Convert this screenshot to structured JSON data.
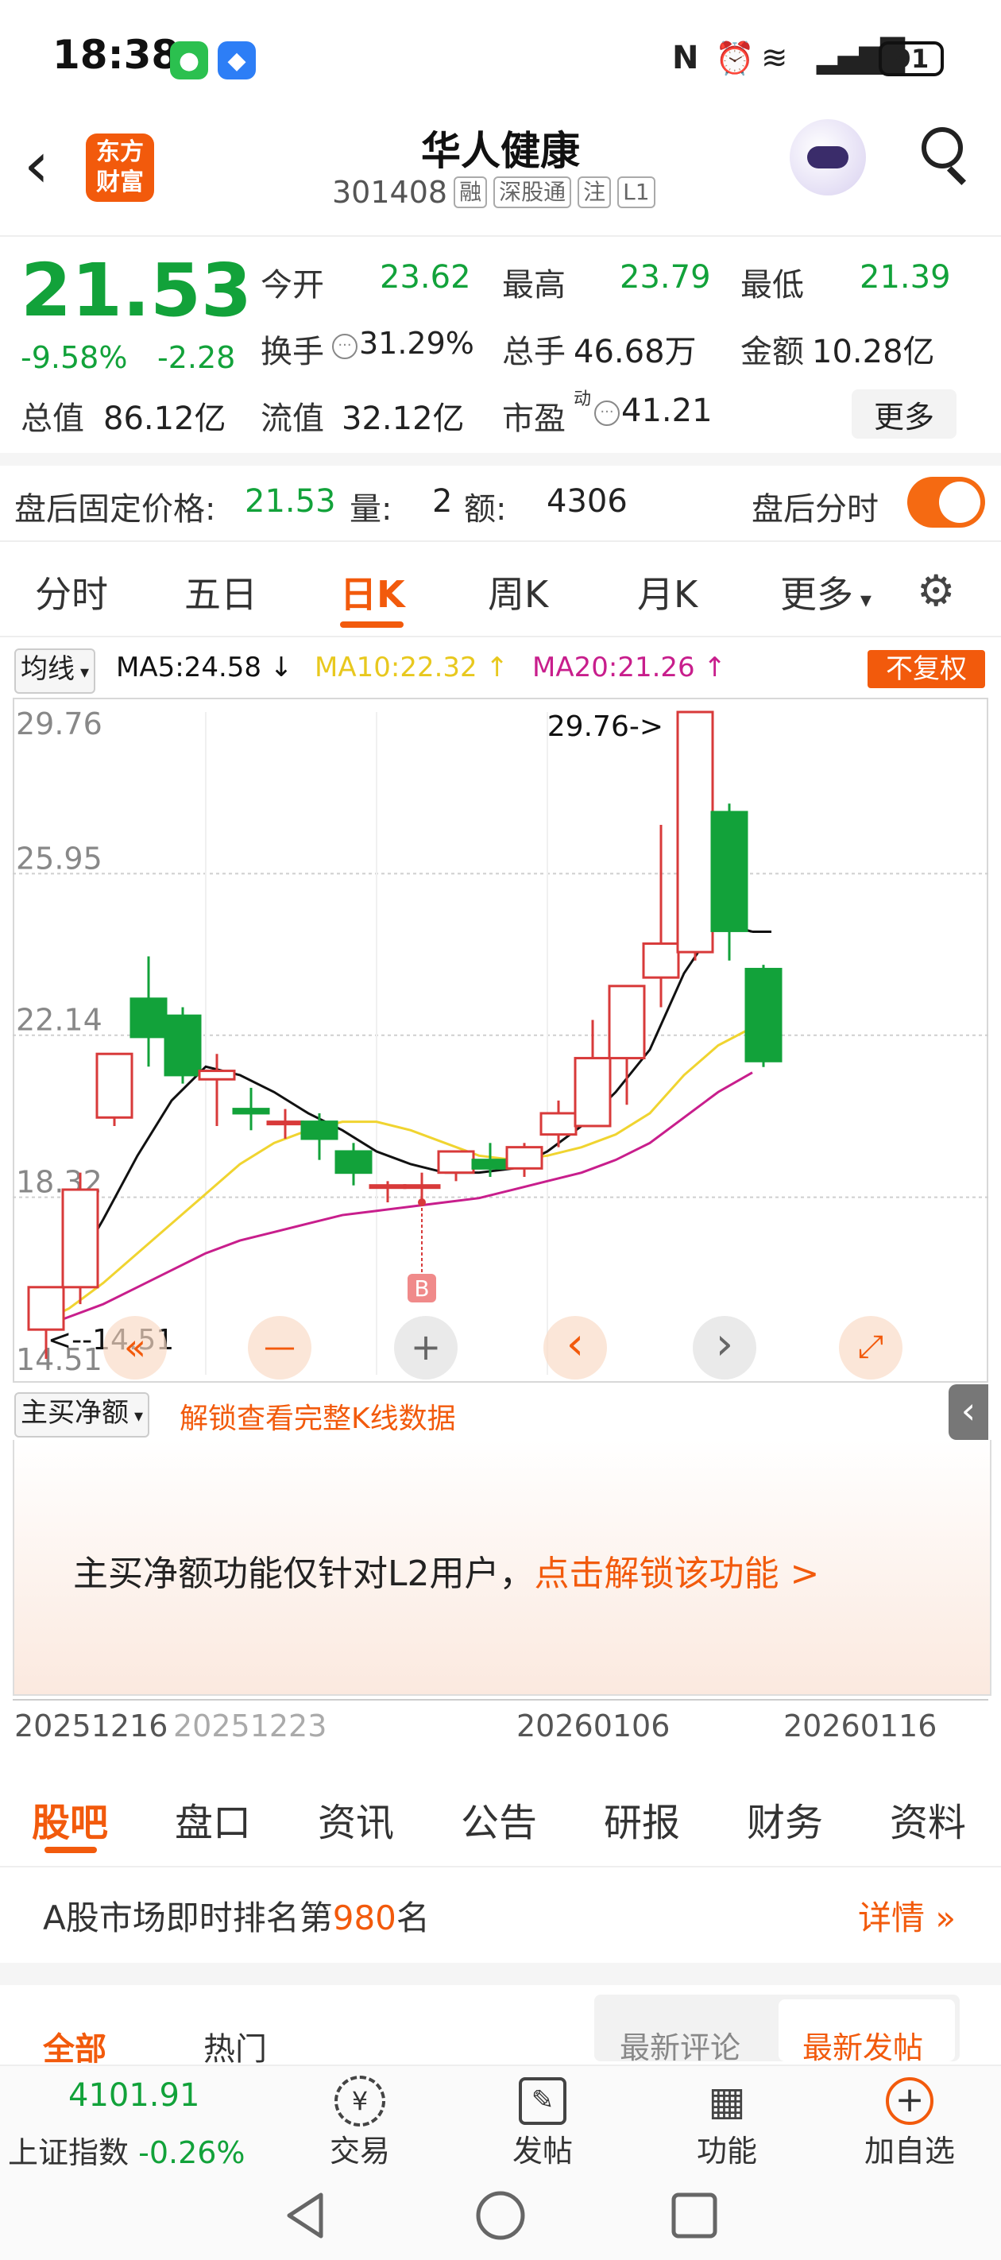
{
  "status_bar": {
    "time": "18:38",
    "battery": "91"
  },
  "header": {
    "stock_name": "华人健康",
    "stock_code": "301408",
    "tags": [
      "融",
      "深股通",
      "注",
      "L1"
    ],
    "logo_line1": "东方",
    "logo_line2": "财富"
  },
  "quote": {
    "price": "21.53",
    "change_pct": "-9.58%",
    "change_amt": "-2.28",
    "open_label": "今开",
    "open": "23.62",
    "high_label": "最高",
    "high": "23.79",
    "low_label": "最低",
    "low": "21.39",
    "turnover_label": "换手",
    "turnover": "31.29%",
    "volume_label": "总手",
    "volume": "46.68万",
    "amount_label": "金额",
    "amount": "10.28亿",
    "mktcap_label": "总值",
    "mktcap": "86.12亿",
    "float_label": "流值",
    "float": "32.12亿",
    "pe_label": "市盈",
    "pe_sup": "动",
    "pe": "41.21",
    "more": "更多"
  },
  "after_hours": {
    "label": "盘后固定价格:",
    "price": "21.53",
    "vol_label": "量:",
    "vol": "2",
    "amt_label": "额:",
    "amt": "4306",
    "toggle_label": "盘后分时",
    "toggle_on": true
  },
  "tabs": [
    "分时",
    "五日",
    "日K",
    "周K",
    "月K",
    "更多"
  ],
  "active_tab": "日K",
  "ma_row": {
    "selector": "均线",
    "ma5": "MA5:24.58",
    "ma10": "MA10:22.32",
    "ma20": "MA20:21.26",
    "adjust": "不复权"
  },
  "colors": {
    "accent": "#f25a0c",
    "up": "#d83a3a",
    "down": "#12a23a",
    "ma5": "#111111",
    "ma10": "#f0d430",
    "ma20": "#c81e8c"
  },
  "chart_data": {
    "type": "candlestick",
    "ylim": [
      14.51,
      29.76
    ],
    "y_ticks": [
      "29.76",
      "25.95",
      "22.14",
      "18.32",
      "14.51"
    ],
    "max_label": "29.76->",
    "min_label": "<--14.51",
    "marker": "B",
    "x_date_labels": [
      "20251216",
      "20251223",
      "20260106",
      "20260116"
    ],
    "candles": [
      {
        "o": 15.2,
        "h": 16.1,
        "l": 14.51,
        "c": 16.2
      },
      {
        "o": 16.2,
        "h": 18.9,
        "l": 15.8,
        "c": 18.5
      },
      {
        "o": 20.2,
        "h": 21.7,
        "l": 20.0,
        "c": 21.7
      },
      {
        "o": 23.0,
        "h": 24.0,
        "l": 21.4,
        "c": 22.1
      },
      {
        "o": 22.6,
        "h": 22.8,
        "l": 21.0,
        "c": 21.2
      },
      {
        "o": 21.1,
        "h": 21.7,
        "l": 20.0,
        "c": 21.3
      },
      {
        "o": 20.4,
        "h": 20.9,
        "l": 19.9,
        "c": 20.3
      },
      {
        "o": 20.1,
        "h": 20.4,
        "l": 19.7,
        "c": 20.1
      },
      {
        "o": 20.1,
        "h": 20.3,
        "l": 19.2,
        "c": 19.7
      },
      {
        "o": 19.4,
        "h": 19.6,
        "l": 18.6,
        "c": 18.9
      },
      {
        "o": 18.6,
        "h": 18.7,
        "l": 18.2,
        "c": 18.6
      },
      {
        "o": 18.6,
        "h": 18.9,
        "l": 18.2,
        "c": 18.6
      },
      {
        "o": 18.9,
        "h": 19.4,
        "l": 18.7,
        "c": 19.4
      },
      {
        "o": 19.2,
        "h": 19.6,
        "l": 18.8,
        "c": 19.0
      },
      {
        "o": 19.0,
        "h": 19.6,
        "l": 18.8,
        "c": 19.5
      },
      {
        "o": 19.8,
        "h": 20.6,
        "l": 19.5,
        "c": 20.3
      },
      {
        "o": 20.0,
        "h": 22.5,
        "l": 20.0,
        "c": 21.6
      },
      {
        "o": 21.6,
        "h": 23.3,
        "l": 20.5,
        "c": 23.3
      },
      {
        "o": 23.5,
        "h": 27.1,
        "l": 22.8,
        "c": 24.3
      },
      {
        "o": 24.1,
        "h": 29.76,
        "l": 23.9,
        "c": 29.76
      },
      {
        "o": 27.4,
        "h": 27.6,
        "l": 23.9,
        "c": 24.6
      },
      {
        "o": 23.7,
        "h": 23.8,
        "l": 21.39,
        "c": 21.53
      }
    ],
    "ma5": [
      15.2,
      16.4,
      17.8,
      19.3,
      20.6,
      21.4,
      21.2,
      20.8,
      20.3,
      19.9,
      19.4,
      19.1,
      18.9,
      18.9,
      19.0,
      19.4,
      20.0,
      20.8,
      21.8,
      23.6,
      24.8,
      24.58
    ],
    "ma10": [
      15.3,
      15.7,
      16.3,
      17.0,
      17.7,
      18.4,
      19.1,
      19.6,
      19.9,
      20.1,
      20.1,
      19.9,
      19.6,
      19.3,
      19.2,
      19.3,
      19.5,
      19.8,
      20.3,
      21.2,
      21.9,
      22.32
    ],
    "ma20": [
      15.2,
      15.5,
      15.8,
      16.2,
      16.6,
      17.0,
      17.3,
      17.5,
      17.7,
      17.9,
      18.0,
      18.1,
      18.2,
      18.3,
      18.5,
      18.7,
      18.9,
      19.2,
      19.6,
      20.2,
      20.8,
      21.26
    ]
  },
  "chart_buttons": [
    "«",
    "—",
    "+",
    "‹",
    "›",
    "⤢"
  ],
  "sub_indicator": {
    "selector": "主买净额",
    "unlock_link": "解锁查看完整K线数据"
  },
  "locked_panel": {
    "text": "主买净额功能仅针对L2用户，",
    "action": "点击解锁该功能 >"
  },
  "bottom_tabs": [
    "股吧",
    "盘口",
    "资讯",
    "公告",
    "研报",
    "财务",
    "资料"
  ],
  "active_bottom_tab": "股吧",
  "rank": {
    "prefix": "A股市场即时排名第",
    "number": "980",
    "suffix": "名",
    "details": "详情"
  },
  "sub_tabs": {
    "all": "全部",
    "hot": "热门",
    "latest_comment": "最新评论",
    "latest_post": "最新发帖"
  },
  "index": {
    "value": "4101.91",
    "name": "上证指数",
    "change": "-0.26%"
  },
  "nav": [
    "交易",
    "发帖",
    "功能",
    "加自选"
  ]
}
